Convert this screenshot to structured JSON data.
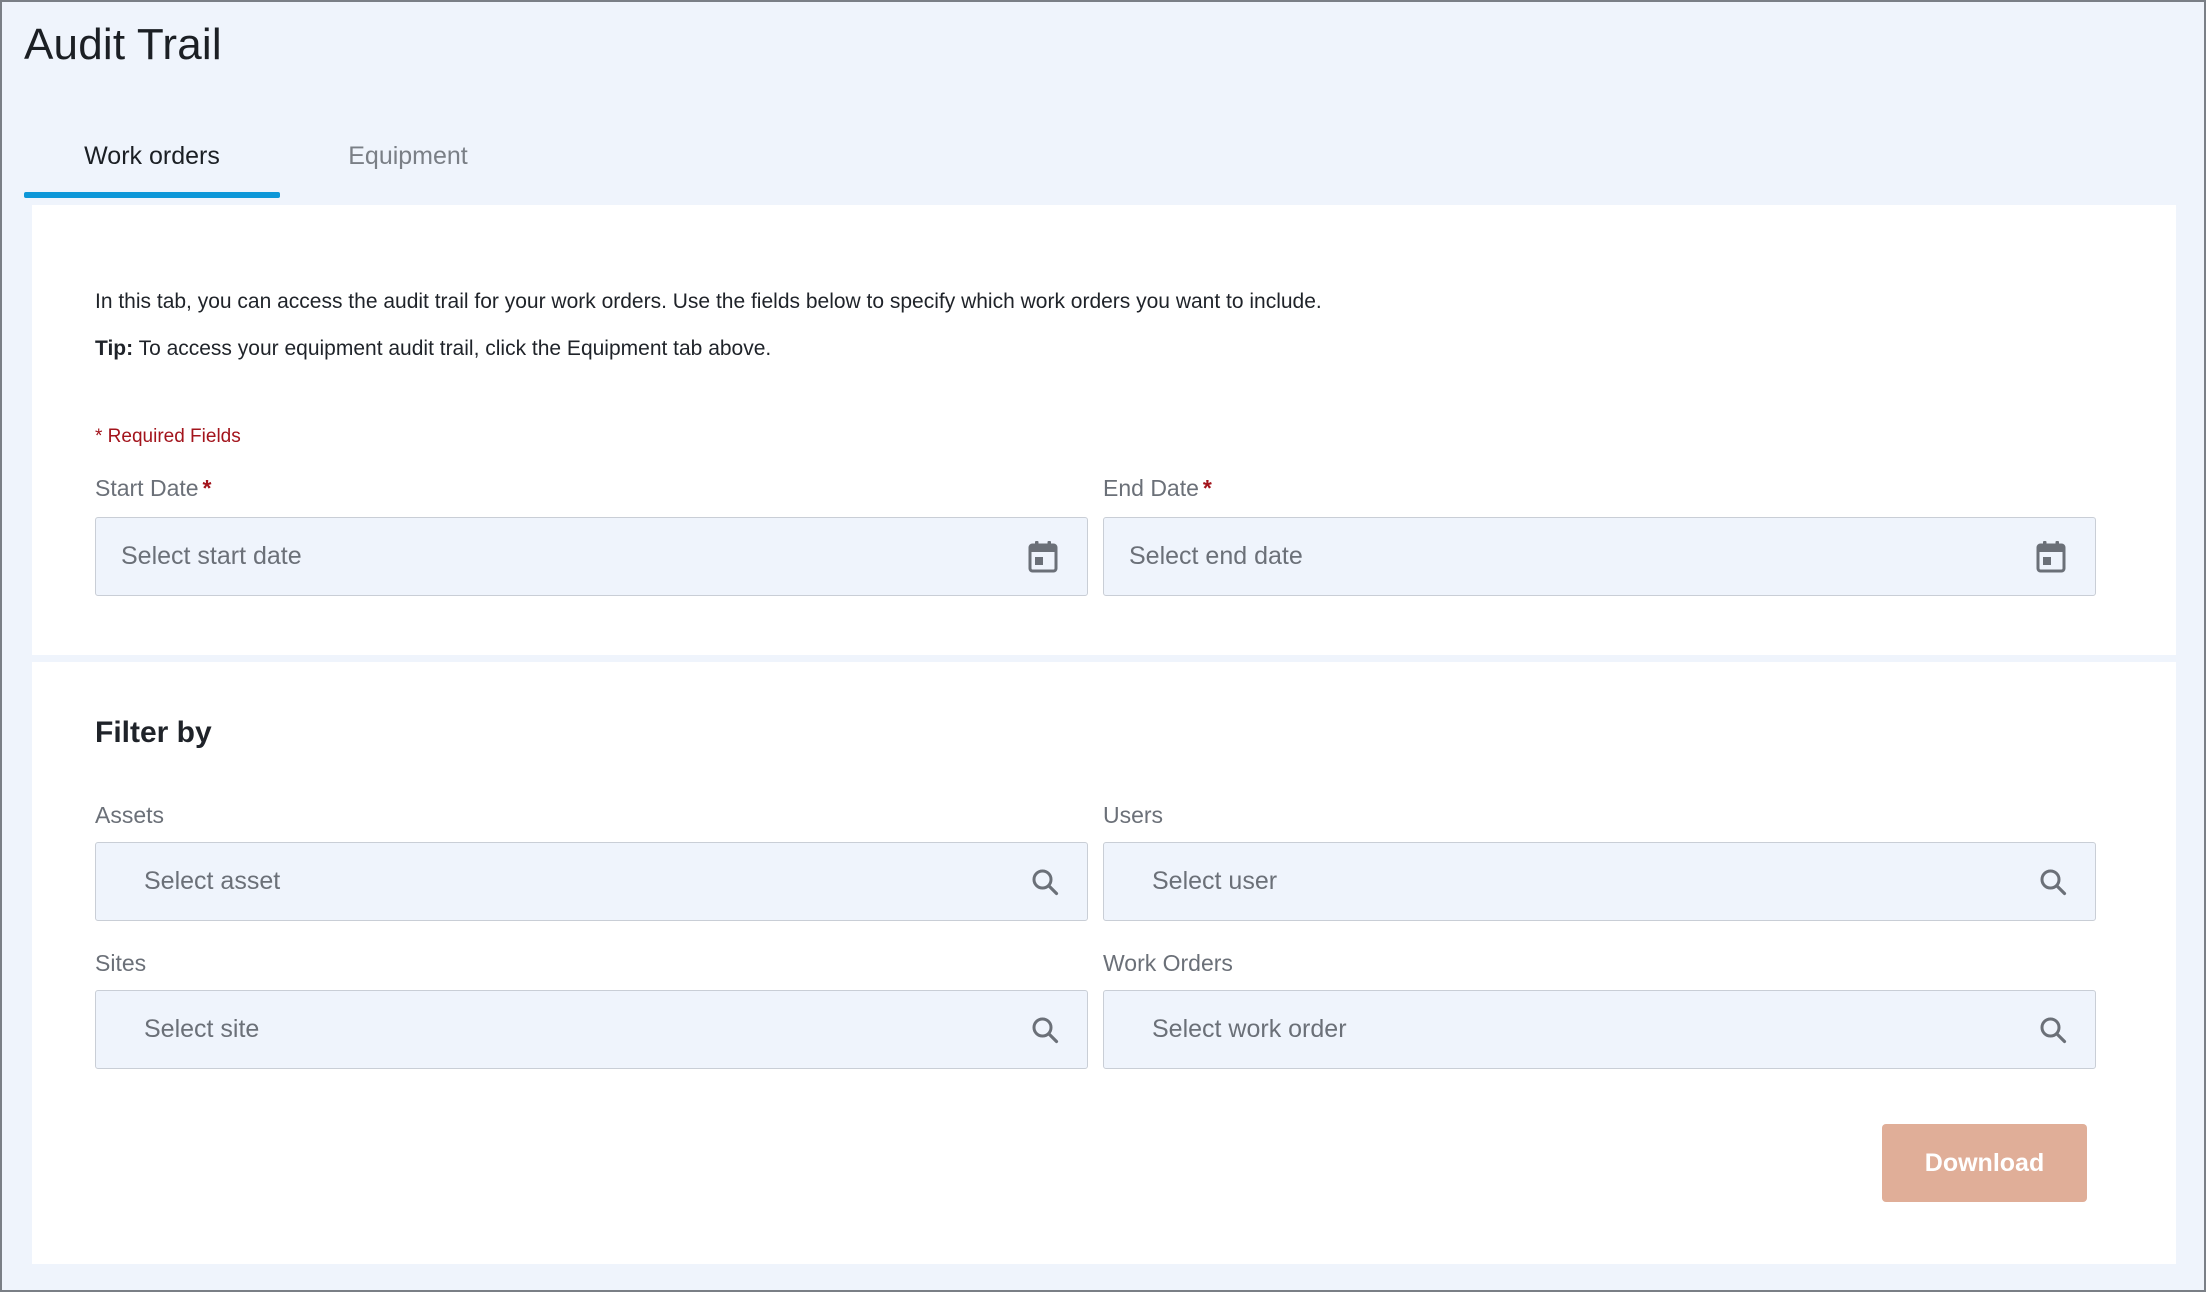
{
  "page": {
    "title": "Audit Trail"
  },
  "tabs": [
    {
      "label": "Work orders",
      "active": true
    },
    {
      "label": "Equipment",
      "active": false
    }
  ],
  "intro": {
    "text": "In this tab, you can access the audit trail for your work orders. Use the fields below to specify which work orders you want to include.",
    "tip_label": "Tip:",
    "tip_text": " To access your equipment audit trail, click the Equipment tab above."
  },
  "required_note": "* Required Fields",
  "dates": {
    "start": {
      "label": "Start Date",
      "required_mark": "*",
      "placeholder": "Select start date",
      "icon": "calendar-icon"
    },
    "end": {
      "label": "End Date",
      "required_mark": "*",
      "placeholder": "Select end date",
      "icon": "calendar-icon"
    }
  },
  "filter": {
    "heading": "Filter by",
    "assets": {
      "label": "Assets",
      "placeholder": "Select asset",
      "icon": "search-icon"
    },
    "users": {
      "label": "Users",
      "placeholder": "Select user",
      "icon": "search-icon"
    },
    "sites": {
      "label": "Sites",
      "placeholder": "Select site",
      "icon": "search-icon"
    },
    "work_orders": {
      "label": "Work Orders",
      "placeholder": "Select work order",
      "icon": "search-icon"
    }
  },
  "download": {
    "label": "Download"
  },
  "colors": {
    "accent": "#0d97d8",
    "required": "#a3141c",
    "download_bg": "#e0ae98",
    "page_bg": "#eff4fc"
  }
}
